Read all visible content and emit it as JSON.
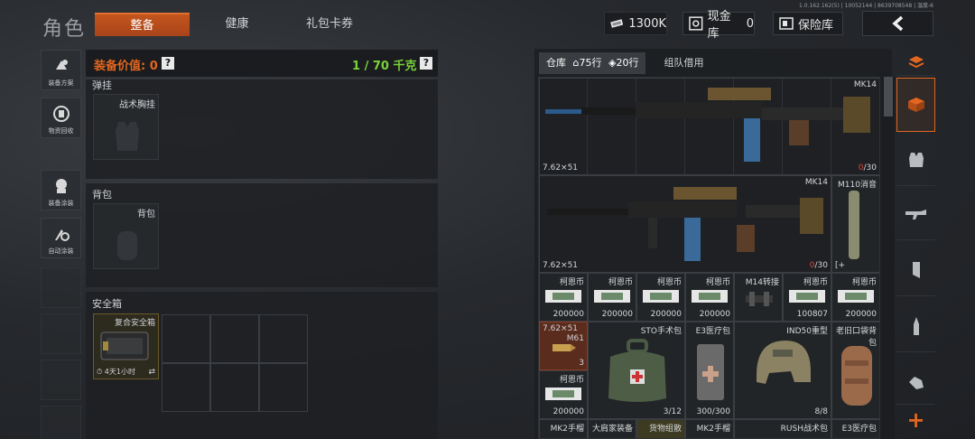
{
  "header": {
    "build_info": "1.0.162.162(5) | 10052144 | 8639708548 | 温度-6",
    "title": "角色",
    "tabs": [
      {
        "label": "整备",
        "active": true
      },
      {
        "label": "健康",
        "active": false
      },
      {
        "label": "礼包卡券",
        "active": false
      }
    ],
    "currency": "1300K",
    "cash_vault_label": "现金库",
    "cash_vault_count": "0",
    "insurance_label": "保险库"
  },
  "sidebar": {
    "items": [
      {
        "label": "装备方案",
        "icon": "outfit-icon"
      },
      {
        "label": "物资回收",
        "icon": "recycle-icon"
      },
      {
        "label": "装备涂装",
        "icon": "paint-icon"
      },
      {
        "label": "自动涂装",
        "icon": "auto-paint-icon"
      }
    ]
  },
  "loadout": {
    "value_label": "装备价值: 0",
    "weight": "1 / 70 千克",
    "sections": {
      "rig": {
        "label": "弹挂",
        "slot_label": "战术胸挂"
      },
      "backpack": {
        "label": "背包",
        "slot_label": "背包"
      },
      "safebox": {
        "label": "安全箱",
        "item_name": "复合安全箱",
        "time": "4天1小时"
      }
    }
  },
  "inventory": {
    "tabs": [
      {
        "label": "仓库",
        "active": true
      },
      {
        "label": "75行",
        "active": false,
        "icon": "house-icon"
      },
      {
        "label": "20行",
        "active": false,
        "icon": "tag-icon"
      },
      {
        "label": "组队借用",
        "active": false
      }
    ],
    "weapons": [
      {
        "name": "MK14",
        "caliber": "7.62×51",
        "ammo_current": "0",
        "ammo_sep": "/30"
      },
      {
        "name": "MK14",
        "caliber": "7.62×51",
        "ammo_current": "0",
        "ammo_sep": "/30"
      }
    ],
    "suppressor": {
      "name": "M110消音"
    },
    "cash_row": [
      {
        "name": "柯恩币",
        "count": "200000"
      },
      {
        "name": "柯恩币",
        "count": "200000"
      },
      {
        "name": "柯恩币",
        "count": "200000"
      },
      {
        "name": "柯恩币",
        "count": "200000"
      },
      {
        "name": "M14转接",
        "count": ""
      },
      {
        "name": "柯恩币",
        "count": "100807"
      },
      {
        "name": "柯恩币",
        "count": "200000"
      }
    ],
    "row4": {
      "ammo": {
        "caliber": "7.62×51",
        "name": "M61",
        "count": "3"
      },
      "cash": {
        "name": "柯恩币",
        "count": "200000"
      },
      "surgery": {
        "name": "STO手术包",
        "count": "3/12"
      },
      "medkit": {
        "name": "E3医疗包",
        "count": "300/300"
      },
      "helmet": {
        "name": "IND50重型",
        "count": "8/8"
      },
      "pouch": {
        "name": "老旧口袋背包"
      }
    },
    "row5": [
      "MK2手榴",
      "大肩家装备",
      "货物组散",
      "MK2手榴",
      "RUSH战术包",
      "E3医疗包"
    ]
  },
  "colors": {
    "accent": "#e2661f",
    "weight_green": "#7ad33a",
    "ammo_red": "#d94b3c"
  }
}
